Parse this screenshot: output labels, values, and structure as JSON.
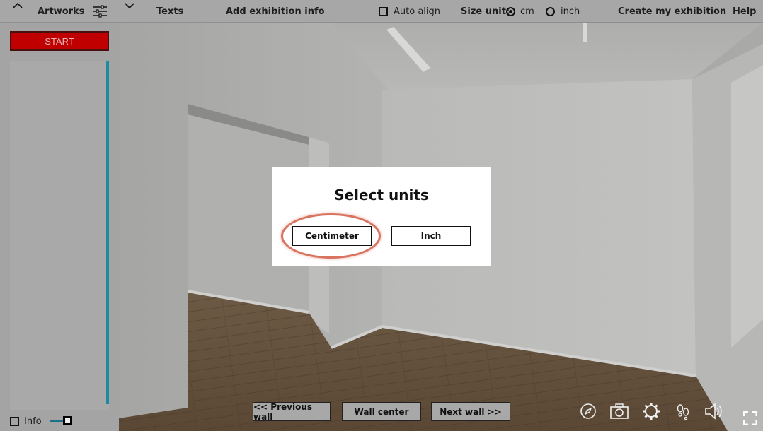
{
  "topbar": {
    "artworks_label": "Artworks",
    "texts_label": "Texts",
    "add_info_label": "Add exhibition info",
    "auto_align_label": "Auto align",
    "auto_align_checked": false,
    "size_unit_label": "Size unit:",
    "unit_cm_label": "cm",
    "unit_inch_label": "inch",
    "selected_unit": "cm",
    "create_label": "Create my exhibition",
    "help_label": "Help"
  },
  "left_panel": {
    "start_label": "START",
    "info_label": "Info",
    "info_checked": false
  },
  "modal": {
    "title": "Select units",
    "centimeter_label": "Centimeter",
    "inch_label": "Inch"
  },
  "wall_nav": {
    "previous_label": "<< Previous wall",
    "center_label": "Wall center",
    "next_label": "Next wall >>"
  },
  "icons": [
    "chevron-up-icon",
    "filter-sliders-icon",
    "chevron-down-icon",
    "compass-icon",
    "camera-icon",
    "settings-gear-icon",
    "footsteps-icon",
    "speaker-icon",
    "fullscreen-icon"
  ],
  "colors": {
    "start_button": "#c00000",
    "scrollbar_accent": "#1e8aa2",
    "highlight_ring": "#d9735f"
  }
}
